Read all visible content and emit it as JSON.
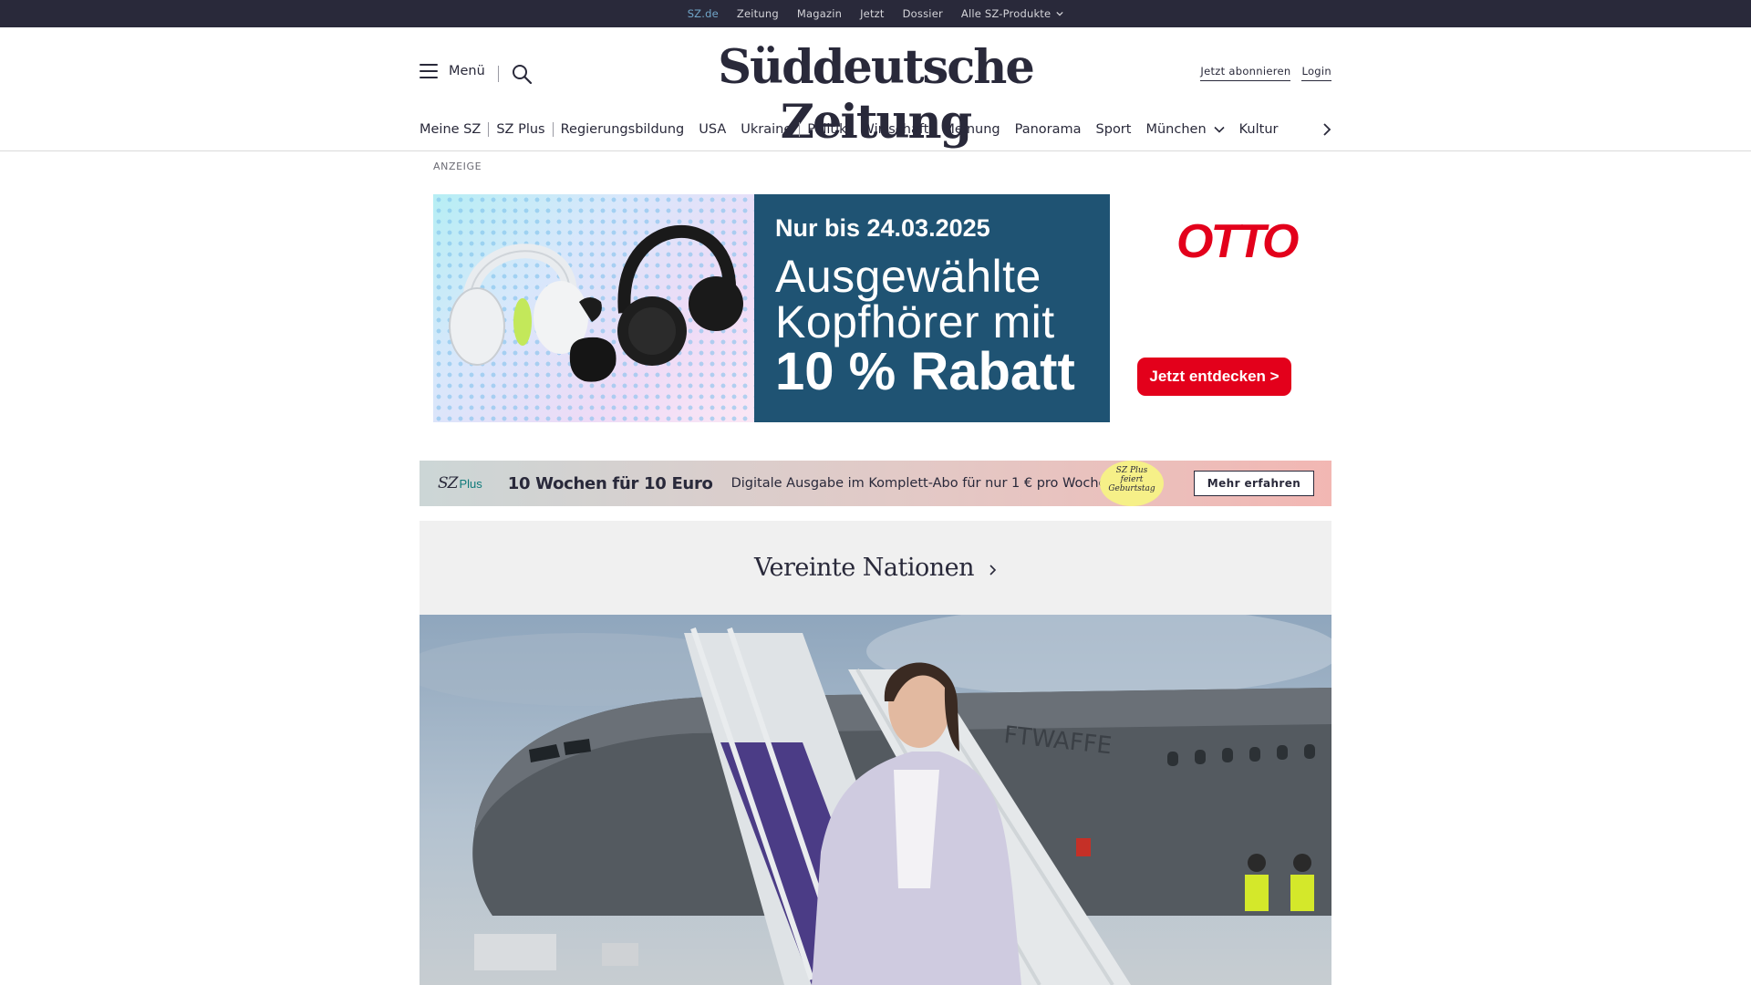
{
  "topbar": {
    "links": [
      "SZ.de",
      "Zeitung",
      "Magazin",
      "Jetzt",
      "Dossier",
      "Alle SZ-Produkte"
    ],
    "active_index": 0
  },
  "header": {
    "menu_label": "Menü",
    "logo_text": "Süddeutsche Zeitung",
    "subscribe_label": "Jetzt abonnieren",
    "login_label": "Login"
  },
  "nav": {
    "items": [
      "Meine SZ",
      "SZ Plus",
      "Regierungsbildung",
      "USA",
      "Ukraine",
      "Politik",
      "Wirtschaft",
      "Meinung",
      "Panorama",
      "Sport",
      "München",
      "Kultur"
    ]
  },
  "ad": {
    "label": "ANZEIGE",
    "date_line": "Nur bis 24.03.2025",
    "line1": "Ausgewählte",
    "line2": "Kopfhörer mit",
    "line3": "10 % Rabatt",
    "brand": "OTTO",
    "cta": "Jetzt entdecken >",
    "colors": {
      "panel": "#1f5373",
      "brand": "#e3001b"
    }
  },
  "promo": {
    "logo": "SZ",
    "logo_plus": "Plus",
    "title": "10 Wochen für 10 Euro",
    "subtitle": "Digitale Ausgabe im Komplett-Abo für nur 1 € pro Woche.",
    "badge_line1": "SZ Plus",
    "badge_line2": "feiert",
    "badge_line3": "Geburtstag",
    "button": "Mehr erfahren"
  },
  "dossier": {
    "title": "Vereinte Nationen"
  },
  "hero": {
    "plane_lettering": "FTWAFFE"
  }
}
